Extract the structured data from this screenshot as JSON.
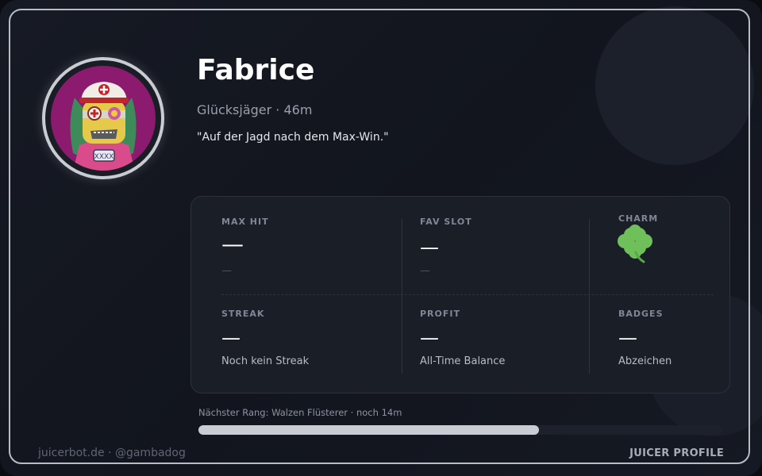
{
  "profile": {
    "name": "Fabrice",
    "subtitle": "Glücksjäger · 46m",
    "quote": "\"Auf der Jagd nach dem Max-Win.\""
  },
  "stats": {
    "max_hit": {
      "label": "MAX HIT",
      "value": "—",
      "sub": "—"
    },
    "fav_slot": {
      "label": "FAV SLOT",
      "value": "—",
      "sub": "—"
    },
    "charm": {
      "label": "CHARM",
      "icon": "four-leaf-clover-icon"
    },
    "streak": {
      "label": "STREAK",
      "value": "—",
      "sub": "Noch kein Streak"
    },
    "profit": {
      "label": "PROFIT",
      "value": "—",
      "sub": "All-Time Balance"
    },
    "badges": {
      "label": "BADGES",
      "value": "—",
      "sub": "Abzeichen"
    }
  },
  "rank": {
    "text": "Nächster Rang: Walzen Flüsterer · noch 14m",
    "progress_percent": 65
  },
  "footer": {
    "left": "juicerbot.de · @gambadog",
    "right": "JUICER PROFILE"
  },
  "colors": {
    "background": "#141821",
    "panel": "#1a1e27",
    "accent": "#c9ccd2",
    "clover": "#6fbf5a",
    "avatar_bg": "#8c1a6e"
  }
}
